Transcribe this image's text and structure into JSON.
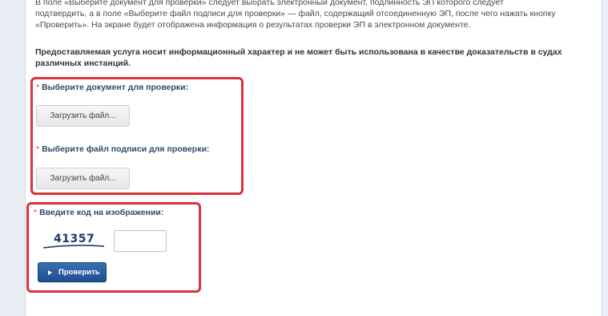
{
  "description": "В поле «Выберите документ для проверки» следует выбрать электронный документ, подлинность ЭП которого следует подтвердить, а в поле «Выберите файл подписи для проверки» — файл, содержащий отсоединенную ЭП, после чего нажать кнопку «Проверить». На экране будет отображена информация о результатах проверки ЭП в электронном документе.",
  "notice": "Предоставляемая услуга носит информационный характер и не может быть использована в качестве доказательств в судах различных инстанций.",
  "form": {
    "required_mark": "*",
    "document_label": "Выберите документ для проверки:",
    "document_button": "Загрузить файл...",
    "signature_label": "Выберите файл подписи для проверки:",
    "signature_button": "Загрузить файл...",
    "captcha_label": "Введите код на изображении:",
    "captcha_code": "41357",
    "captcha_value": "",
    "submit_label": "Проверить"
  },
  "colors": {
    "highlight_border": "#d8333f",
    "label_text": "#2d4a6a",
    "submit_bg": "#1f4d8f"
  }
}
